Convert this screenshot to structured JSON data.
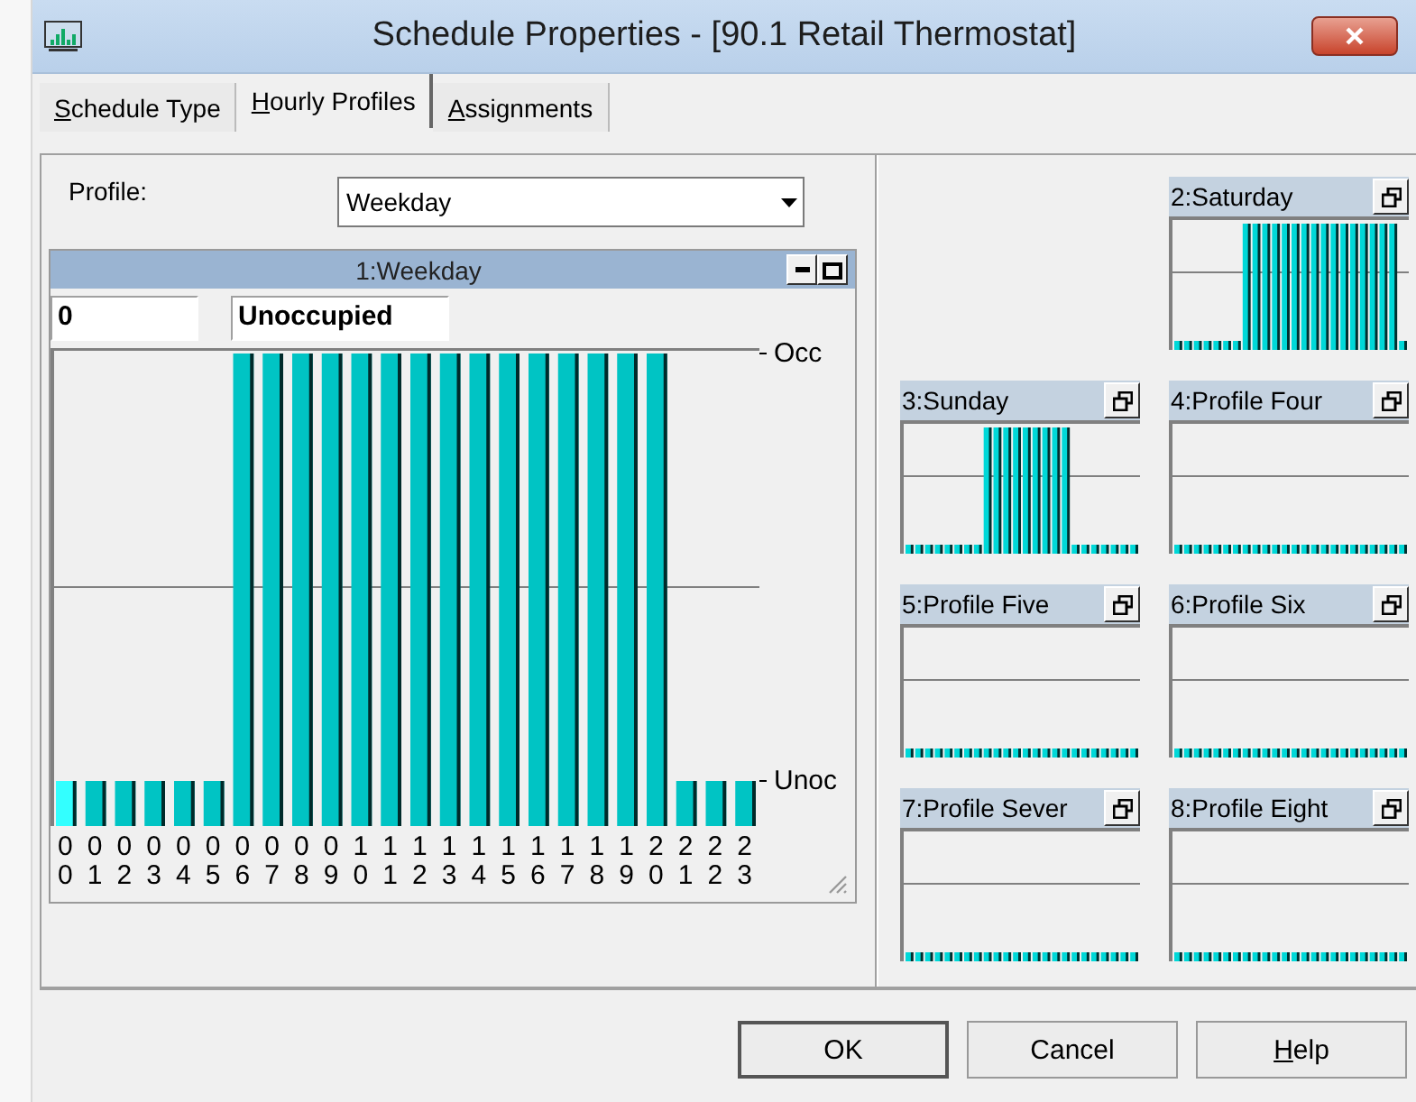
{
  "window": {
    "title": "Schedule Properties - [90.1 Retail Thermostat]"
  },
  "tabs": [
    {
      "label": "Schedule Type",
      "selected": false,
      "mnemonic": true
    },
    {
      "label": "Hourly Profiles",
      "selected": true,
      "mnemonic": true
    },
    {
      "label": "Assignments",
      "selected": false,
      "mnemonic": true
    }
  ],
  "profile_selector": {
    "label": "Profile:",
    "value": "Weekday"
  },
  "main_profile": {
    "title": "1:Weekday",
    "hour_field": "0",
    "state_field": "Unoccupied",
    "levels": [
      "Occ",
      "Unoc"
    ],
    "hours": [
      {
        "label": "00",
        "occupied": false,
        "selected": true
      },
      {
        "label": "01",
        "occupied": false,
        "selected": false
      },
      {
        "label": "02",
        "occupied": false,
        "selected": false
      },
      {
        "label": "03",
        "occupied": false,
        "selected": false
      },
      {
        "label": "04",
        "occupied": false,
        "selected": false
      },
      {
        "label": "05",
        "occupied": false,
        "selected": false
      },
      {
        "label": "06",
        "occupied": true,
        "selected": false
      },
      {
        "label": "07",
        "occupied": true,
        "selected": false
      },
      {
        "label": "08",
        "occupied": true,
        "selected": false
      },
      {
        "label": "09",
        "occupied": true,
        "selected": false
      },
      {
        "label": "10",
        "occupied": true,
        "selected": false
      },
      {
        "label": "11",
        "occupied": true,
        "selected": false
      },
      {
        "label": "12",
        "occupied": true,
        "selected": false
      },
      {
        "label": "13",
        "occupied": true,
        "selected": false
      },
      {
        "label": "14",
        "occupied": true,
        "selected": false
      },
      {
        "label": "15",
        "occupied": true,
        "selected": false
      },
      {
        "label": "16",
        "occupied": true,
        "selected": false
      },
      {
        "label": "17",
        "occupied": true,
        "selected": false
      },
      {
        "label": "18",
        "occupied": true,
        "selected": false
      },
      {
        "label": "19",
        "occupied": true,
        "selected": false
      },
      {
        "label": "20",
        "occupied": true,
        "selected": false
      },
      {
        "label": "21",
        "occupied": false,
        "selected": false
      },
      {
        "label": "22",
        "occupied": false,
        "selected": false
      },
      {
        "label": "23",
        "occupied": false,
        "selected": false
      }
    ]
  },
  "thumbnails": [
    {
      "title": "2:Saturday",
      "occupied": [
        false,
        false,
        false,
        false,
        false,
        false,
        false,
        true,
        true,
        true,
        true,
        true,
        true,
        true,
        true,
        true,
        true,
        true,
        true,
        true,
        true,
        true,
        true,
        false
      ]
    },
    {
      "title": "3:Sunday",
      "occupied": [
        false,
        false,
        false,
        false,
        false,
        false,
        false,
        false,
        true,
        true,
        true,
        true,
        true,
        true,
        true,
        true,
        true,
        false,
        false,
        false,
        false,
        false,
        false,
        false
      ]
    },
    {
      "title": "4:Profile Four",
      "occupied": [
        false,
        false,
        false,
        false,
        false,
        false,
        false,
        false,
        false,
        false,
        false,
        false,
        false,
        false,
        false,
        false,
        false,
        false,
        false,
        false,
        false,
        false,
        false,
        false
      ]
    },
    {
      "title": "5:Profile Five",
      "occupied": [
        false,
        false,
        false,
        false,
        false,
        false,
        false,
        false,
        false,
        false,
        false,
        false,
        false,
        false,
        false,
        false,
        false,
        false,
        false,
        false,
        false,
        false,
        false,
        false
      ]
    },
    {
      "title": "6:Profile Six",
      "occupied": [
        false,
        false,
        false,
        false,
        false,
        false,
        false,
        false,
        false,
        false,
        false,
        false,
        false,
        false,
        false,
        false,
        false,
        false,
        false,
        false,
        false,
        false,
        false,
        false
      ]
    },
    {
      "title": "7:Profile Sever",
      "occupied": [
        false,
        false,
        false,
        false,
        false,
        false,
        false,
        false,
        false,
        false,
        false,
        false,
        false,
        false,
        false,
        false,
        false,
        false,
        false,
        false,
        false,
        false,
        false,
        false
      ]
    },
    {
      "title": "8:Profile Eight",
      "occupied": [
        false,
        false,
        false,
        false,
        false,
        false,
        false,
        false,
        false,
        false,
        false,
        false,
        false,
        false,
        false,
        false,
        false,
        false,
        false,
        false,
        false,
        false,
        false,
        false
      ]
    }
  ],
  "buttons": [
    {
      "label": "OK",
      "mnemonic": false,
      "default": true
    },
    {
      "label": "Cancel",
      "mnemonic": false,
      "default": false
    },
    {
      "label": "Help",
      "mnemonic": true,
      "default": false
    }
  ]
}
